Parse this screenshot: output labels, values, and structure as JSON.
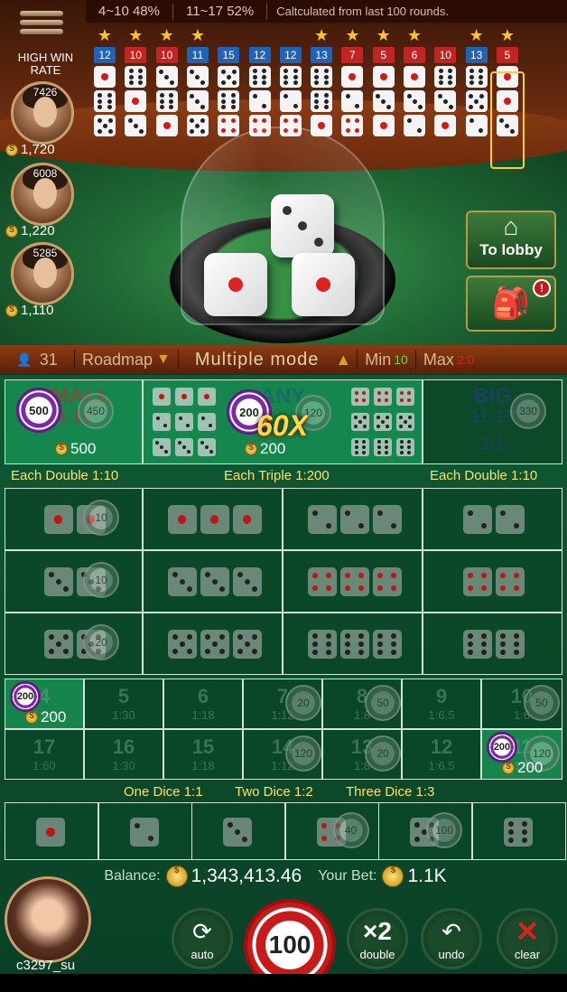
{
  "stats": {
    "range_small": "4~10",
    "pct_small": "48%",
    "range_big": "11~17",
    "pct_big": "52%",
    "note": "Caltculated from last 100 rounds."
  },
  "high_win_rate": "HIGH WIN RATE",
  "players": [
    {
      "id": "7426",
      "balance": "1,720"
    },
    {
      "id": "6008",
      "balance": "1,220"
    },
    {
      "id": "5285",
      "balance": "1,110"
    }
  ],
  "history": [
    {
      "star": true,
      "sum": "12",
      "color": "blue",
      "dice": [
        1,
        6,
        5
      ]
    },
    {
      "star": true,
      "sum": "10",
      "color": "red",
      "dice": [
        6,
        1,
        3
      ]
    },
    {
      "star": true,
      "sum": "10",
      "color": "red",
      "dice": [
        3,
        6,
        1
      ]
    },
    {
      "star": true,
      "sum": "11",
      "color": "blue",
      "dice": [
        3,
        3,
        5
      ]
    },
    {
      "star": false,
      "sum": "15",
      "color": "blue",
      "dice": [
        5,
        6,
        4
      ]
    },
    {
      "star": false,
      "sum": "12",
      "color": "blue",
      "dice": [
        6,
        2,
        4
      ]
    },
    {
      "star": false,
      "sum": "12",
      "color": "blue",
      "dice": [
        6,
        2,
        4
      ]
    },
    {
      "star": true,
      "sum": "13",
      "color": "blue",
      "dice": [
        6,
        6,
        1
      ]
    },
    {
      "star": true,
      "sum": "7",
      "color": "red",
      "dice": [
        1,
        2,
        4
      ]
    },
    {
      "star": true,
      "sum": "5",
      "color": "red",
      "dice": [
        1,
        3,
        1
      ]
    },
    {
      "star": true,
      "sum": "6",
      "color": "red",
      "dice": [
        1,
        3,
        2
      ]
    },
    {
      "star": false,
      "sum": "10",
      "color": "red",
      "dice": [
        6,
        3,
        1
      ]
    },
    {
      "star": true,
      "sum": "13",
      "color": "blue",
      "dice": [
        6,
        5,
        2
      ]
    },
    {
      "star": true,
      "sum": "5",
      "color": "red",
      "dice": [
        1,
        1,
        3
      ]
    }
  ],
  "dome_dice": [
    3,
    1,
    1
  ],
  "buttons": {
    "lobby": "To lobby",
    "bag_badge": "!"
  },
  "bar": {
    "players": "31",
    "roadmap": "Roadmap",
    "mode": "Multiple mode",
    "min_label": "Min",
    "min_val": "10",
    "max_label": "Max",
    "max_val": "2.0"
  },
  "top_bets": {
    "small": {
      "title": "SMALL",
      "range": "4-10",
      "chips": [
        "500",
        "450"
      ],
      "amount": "500"
    },
    "any": {
      "title": "ANY",
      "chips": [
        "200",
        "120"
      ],
      "amount": "200",
      "multiplier": "60X"
    },
    "big": {
      "title": "BIG",
      "range": "11-17",
      "odds": "1:1",
      "chips": [
        "330"
      ]
    }
  },
  "headers": {
    "left": "Each Double 1:10",
    "mid": "Each Triple 1:200",
    "right": "Each Double 1:10"
  },
  "combo_chips": [
    "10",
    "10",
    "20"
  ],
  "totals_row1": [
    {
      "n": "4",
      "o": "1:60",
      "chip": "200",
      "amount": "200",
      "hi": true
    },
    {
      "n": "5",
      "o": "1:30"
    },
    {
      "n": "6",
      "o": "1:18"
    },
    {
      "n": "7",
      "o": "1:12",
      "ghost": "20"
    },
    {
      "n": "8",
      "o": "1:8",
      "ghost": "50"
    },
    {
      "n": "9",
      "o": "1:6.5"
    },
    {
      "n": "10",
      "o": "1:6",
      "ghost": "50"
    }
  ],
  "totals_row2": [
    {
      "n": "17",
      "o": "1:60"
    },
    {
      "n": "16",
      "o": "1:30"
    },
    {
      "n": "15",
      "o": "1:18"
    },
    {
      "n": "14",
      "o": "1:12",
      "ghost": "120"
    },
    {
      "n": "13",
      "o": "1:8",
      "ghost": "20"
    },
    {
      "n": "12",
      "o": "1:6.5"
    },
    {
      "n": "11",
      "o": "1:6",
      "chip": "200",
      "ghost": "120",
      "amount": "200",
      "hi": true
    }
  ],
  "single_header": {
    "one": "One Dice 1:1",
    "two": "Two Dice 1:2",
    "three": "Three Dice 1:3"
  },
  "singles": [
    {
      "v": 1
    },
    {
      "v": 2
    },
    {
      "v": 3
    },
    {
      "v": 4,
      "ghost": "40"
    },
    {
      "v": 5,
      "ghost": "100"
    },
    {
      "v": 6
    }
  ],
  "balance": {
    "label": "Balance:",
    "value": "1,343,413.46",
    "bet_label": "Your Bet:",
    "bet_value": "1.1K"
  },
  "me": {
    "name": "c3297_su"
  },
  "controls": {
    "auto": "auto",
    "chip": "100",
    "double_icon": "×2",
    "double": "double",
    "undo": "undo",
    "clear": "clear"
  }
}
